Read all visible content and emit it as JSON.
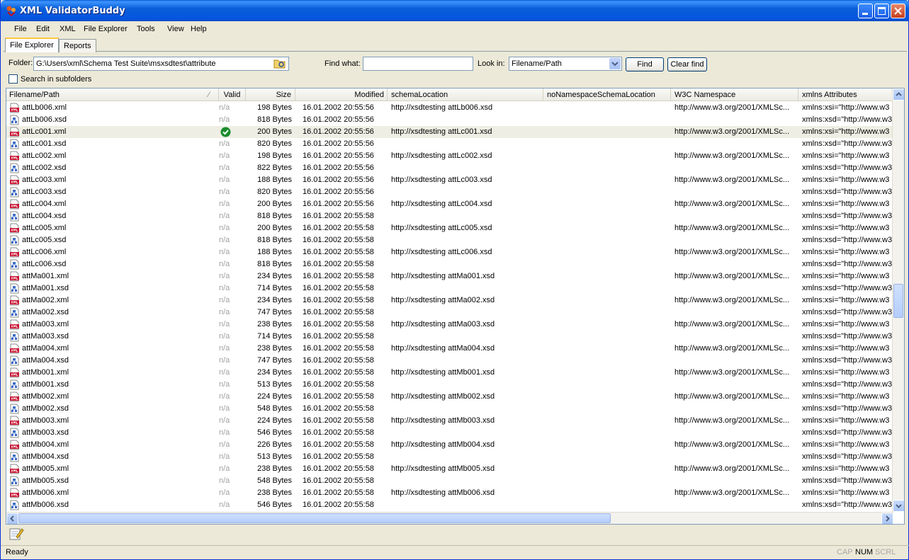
{
  "window": {
    "title": "XML ValidatorBuddy"
  },
  "menu": [
    "File",
    "Edit",
    "XML",
    "File Explorer",
    "Tools",
    "View",
    "Help"
  ],
  "tabs": [
    {
      "label": "File Explorer",
      "active": true
    },
    {
      "label": "Reports",
      "active": false
    }
  ],
  "toolbar": {
    "folder_label": "Folder:",
    "folder_value": "G:\\Users\\xml\\Schema Test Suite\\msxsdtest\\attribute",
    "find_label": "Find what:",
    "find_value": "",
    "lookin_label": "Look in:",
    "lookin_value": "Filename/Path",
    "find_button": "Find",
    "clear_button": "Clear find",
    "subfolders_label": "Search in subfolders",
    "subfolders_checked": false
  },
  "columns": [
    "Filename/Path",
    "Valid",
    "Size",
    "Modified",
    "schemaLocation",
    "noNamespaceSchemaLocation",
    "W3C Namespace",
    "xmlns Attributes"
  ],
  "rows": [
    {
      "name": "attLb006.xml",
      "type": "xml",
      "valid": "n/a",
      "size": "198 Bytes",
      "modified": "16.01.2002 20:55:56",
      "schema": "http://xsdtesting attLb006.xsd",
      "nons": "",
      "w3c": "http://www.w3.org/2001/XMLSc...",
      "xmlns": "xmlns:xsi=\"http://www.w3"
    },
    {
      "name": "attLb006.xsd",
      "type": "xsd",
      "valid": "n/a",
      "size": "818 Bytes",
      "modified": "16.01.2002 20:55:56",
      "schema": "",
      "nons": "",
      "w3c": "",
      "xmlns": "xmlns:xsd=\"http://www.w3"
    },
    {
      "name": "attLc001.xml",
      "type": "xml",
      "valid": "ok",
      "size": "200 Bytes",
      "modified": "16.01.2002 20:55:56",
      "schema": "http://xsdtesting attLc001.xsd",
      "nons": "",
      "w3c": "http://www.w3.org/2001/XMLSc...",
      "xmlns": "xmlns:xsi=\"http://www.w3",
      "selected": true
    },
    {
      "name": "attLc001.xsd",
      "type": "xsd",
      "valid": "n/a",
      "size": "820 Bytes",
      "modified": "16.01.2002 20:55:56",
      "schema": "",
      "nons": "",
      "w3c": "",
      "xmlns": "xmlns:xsd=\"http://www.w3"
    },
    {
      "name": "attLc002.xml",
      "type": "xml",
      "valid": "n/a",
      "size": "198 Bytes",
      "modified": "16.01.2002 20:55:56",
      "schema": "http://xsdtesting attLc002.xsd",
      "nons": "",
      "w3c": "http://www.w3.org/2001/XMLSc...",
      "xmlns": "xmlns:xsi=\"http://www.w3"
    },
    {
      "name": "attLc002.xsd",
      "type": "xsd",
      "valid": "n/a",
      "size": "822 Bytes",
      "modified": "16.01.2002 20:55:56",
      "schema": "",
      "nons": "",
      "w3c": "",
      "xmlns": "xmlns:xsd=\"http://www.w3"
    },
    {
      "name": "attLc003.xml",
      "type": "xml",
      "valid": "n/a",
      "size": "188 Bytes",
      "modified": "16.01.2002 20:55:56",
      "schema": "http://xsdtesting attLc003.xsd",
      "nons": "",
      "w3c": "http://www.w3.org/2001/XMLSc...",
      "xmlns": "xmlns:xsi=\"http://www.w3"
    },
    {
      "name": "attLc003.xsd",
      "type": "xsd",
      "valid": "n/a",
      "size": "820 Bytes",
      "modified": "16.01.2002 20:55:56",
      "schema": "",
      "nons": "",
      "w3c": "",
      "xmlns": "xmlns:xsd=\"http://www.w3"
    },
    {
      "name": "attLc004.xml",
      "type": "xml",
      "valid": "n/a",
      "size": "200 Bytes",
      "modified": "16.01.2002 20:55:56",
      "schema": "http://xsdtesting attLc004.xsd",
      "nons": "",
      "w3c": "http://www.w3.org/2001/XMLSc...",
      "xmlns": "xmlns:xsi=\"http://www.w3"
    },
    {
      "name": "attLc004.xsd",
      "type": "xsd",
      "valid": "n/a",
      "size": "818 Bytes",
      "modified": "16.01.2002 20:55:58",
      "schema": "",
      "nons": "",
      "w3c": "",
      "xmlns": "xmlns:xsd=\"http://www.w3"
    },
    {
      "name": "attLc005.xml",
      "type": "xml",
      "valid": "n/a",
      "size": "200 Bytes",
      "modified": "16.01.2002 20:55:58",
      "schema": "http://xsdtesting attLc005.xsd",
      "nons": "",
      "w3c": "http://www.w3.org/2001/XMLSc...",
      "xmlns": "xmlns:xsi=\"http://www.w3"
    },
    {
      "name": "attLc005.xsd",
      "type": "xsd",
      "valid": "n/a",
      "size": "818 Bytes",
      "modified": "16.01.2002 20:55:58",
      "schema": "",
      "nons": "",
      "w3c": "",
      "xmlns": "xmlns:xsd=\"http://www.w3"
    },
    {
      "name": "attLc006.xml",
      "type": "xml",
      "valid": "n/a",
      "size": "188 Bytes",
      "modified": "16.01.2002 20:55:58",
      "schema": "http://xsdtesting attLc006.xsd",
      "nons": "",
      "w3c": "http://www.w3.org/2001/XMLSc...",
      "xmlns": "xmlns:xsi=\"http://www.w3"
    },
    {
      "name": "attLc006.xsd",
      "type": "xsd",
      "valid": "n/a",
      "size": "818 Bytes",
      "modified": "16.01.2002 20:55:58",
      "schema": "",
      "nons": "",
      "w3c": "",
      "xmlns": "xmlns:xsd=\"http://www.w3"
    },
    {
      "name": "attMa001.xml",
      "type": "xml",
      "valid": "n/a",
      "size": "234 Bytes",
      "modified": "16.01.2002 20:55:58",
      "schema": "http://xsdtesting attMa001.xsd",
      "nons": "",
      "w3c": "http://www.w3.org/2001/XMLSc...",
      "xmlns": "xmlns:xsi=\"http://www.w3"
    },
    {
      "name": "attMa001.xsd",
      "type": "xsd",
      "valid": "n/a",
      "size": "714 Bytes",
      "modified": "16.01.2002 20:55:58",
      "schema": "",
      "nons": "",
      "w3c": "",
      "xmlns": "xmlns:xsd=\"http://www.w3"
    },
    {
      "name": "attMa002.xml",
      "type": "xml",
      "valid": "n/a",
      "size": "234 Bytes",
      "modified": "16.01.2002 20:55:58",
      "schema": "http://xsdtesting attMa002.xsd",
      "nons": "",
      "w3c": "http://www.w3.org/2001/XMLSc...",
      "xmlns": "xmlns:xsi=\"http://www.w3"
    },
    {
      "name": "attMa002.xsd",
      "type": "xsd",
      "valid": "n/a",
      "size": "747 Bytes",
      "modified": "16.01.2002 20:55:58",
      "schema": "",
      "nons": "",
      "w3c": "",
      "xmlns": "xmlns:xsd=\"http://www.w3"
    },
    {
      "name": "attMa003.xml",
      "type": "xml",
      "valid": "n/a",
      "size": "238 Bytes",
      "modified": "16.01.2002 20:55:58",
      "schema": "http://xsdtesting attMa003.xsd",
      "nons": "",
      "w3c": "http://www.w3.org/2001/XMLSc...",
      "xmlns": "xmlns:xsi=\"http://www.w3"
    },
    {
      "name": "attMa003.xsd",
      "type": "xsd",
      "valid": "n/a",
      "size": "714 Bytes",
      "modified": "16.01.2002 20:55:58",
      "schema": "",
      "nons": "",
      "w3c": "",
      "xmlns": "xmlns:xsd=\"http://www.w3"
    },
    {
      "name": "attMa004.xml",
      "type": "xml",
      "valid": "n/a",
      "size": "238 Bytes",
      "modified": "16.01.2002 20:55:58",
      "schema": "http://xsdtesting attMa004.xsd",
      "nons": "",
      "w3c": "http://www.w3.org/2001/XMLSc...",
      "xmlns": "xmlns:xsi=\"http://www.w3"
    },
    {
      "name": "attMa004.xsd",
      "type": "xsd",
      "valid": "n/a",
      "size": "747 Bytes",
      "modified": "16.01.2002 20:55:58",
      "schema": "",
      "nons": "",
      "w3c": "",
      "xmlns": "xmlns:xsd=\"http://www.w3"
    },
    {
      "name": "attMb001.xml",
      "type": "xml",
      "valid": "n/a",
      "size": "234 Bytes",
      "modified": "16.01.2002 20:55:58",
      "schema": "http://xsdtesting attMb001.xsd",
      "nons": "",
      "w3c": "http://www.w3.org/2001/XMLSc...",
      "xmlns": "xmlns:xsi=\"http://www.w3"
    },
    {
      "name": "attMb001.xsd",
      "type": "xsd",
      "valid": "n/a",
      "size": "513 Bytes",
      "modified": "16.01.2002 20:55:58",
      "schema": "",
      "nons": "",
      "w3c": "",
      "xmlns": "xmlns:xsd=\"http://www.w3"
    },
    {
      "name": "attMb002.xml",
      "type": "xml",
      "valid": "n/a",
      "size": "224 Bytes",
      "modified": "16.01.2002 20:55:58",
      "schema": "http://xsdtesting attMb002.xsd",
      "nons": "",
      "w3c": "http://www.w3.org/2001/XMLSc...",
      "xmlns": "xmlns:xsi=\"http://www.w3"
    },
    {
      "name": "attMb002.xsd",
      "type": "xsd",
      "valid": "n/a",
      "size": "548 Bytes",
      "modified": "16.01.2002 20:55:58",
      "schema": "",
      "nons": "",
      "w3c": "",
      "xmlns": "xmlns:xsd=\"http://www.w3"
    },
    {
      "name": "attMb003.xml",
      "type": "xml",
      "valid": "n/a",
      "size": "224 Bytes",
      "modified": "16.01.2002 20:55:58",
      "schema": "http://xsdtesting attMb003.xsd",
      "nons": "",
      "w3c": "http://www.w3.org/2001/XMLSc...",
      "xmlns": "xmlns:xsi=\"http://www.w3"
    },
    {
      "name": "attMb003.xsd",
      "type": "xsd",
      "valid": "n/a",
      "size": "546 Bytes",
      "modified": "16.01.2002 20:55:58",
      "schema": "",
      "nons": "",
      "w3c": "",
      "xmlns": "xmlns:xsd=\"http://www.w3"
    },
    {
      "name": "attMb004.xml",
      "type": "xml",
      "valid": "n/a",
      "size": "226 Bytes",
      "modified": "16.01.2002 20:55:58",
      "schema": "http://xsdtesting attMb004.xsd",
      "nons": "",
      "w3c": "http://www.w3.org/2001/XMLSc...",
      "xmlns": "xmlns:xsi=\"http://www.w3"
    },
    {
      "name": "attMb004.xsd",
      "type": "xsd",
      "valid": "n/a",
      "size": "513 Bytes",
      "modified": "16.01.2002 20:55:58",
      "schema": "",
      "nons": "",
      "w3c": "",
      "xmlns": "xmlns:xsd=\"http://www.w3"
    },
    {
      "name": "attMb005.xml",
      "type": "xml",
      "valid": "n/a",
      "size": "238 Bytes",
      "modified": "16.01.2002 20:55:58",
      "schema": "http://xsdtesting attMb005.xsd",
      "nons": "",
      "w3c": "http://www.w3.org/2001/XMLSc...",
      "xmlns": "xmlns:xsi=\"http://www.w3"
    },
    {
      "name": "attMb005.xsd",
      "type": "xsd",
      "valid": "n/a",
      "size": "548 Bytes",
      "modified": "16.01.2002 20:55:58",
      "schema": "",
      "nons": "",
      "w3c": "",
      "xmlns": "xmlns:xsd=\"http://www.w3"
    },
    {
      "name": "attMb006.xml",
      "type": "xml",
      "valid": "n/a",
      "size": "238 Bytes",
      "modified": "16.01.2002 20:55:58",
      "schema": "http://xsdtesting attMb006.xsd",
      "nons": "",
      "w3c": "http://www.w3.org/2001/XMLSc...",
      "xmlns": "xmlns:xsi=\"http://www.w3"
    },
    {
      "name": "attMb006.xsd",
      "type": "xsd",
      "valid": "n/a",
      "size": "546 Bytes",
      "modified": "16.01.2002 20:55:58",
      "schema": "",
      "nons": "",
      "w3c": "",
      "xmlns": "xmlns:xsd=\"http://www.w3"
    }
  ],
  "status": {
    "text": "Ready",
    "indicators": [
      {
        "label": "CAP",
        "active": false
      },
      {
        "label": "NUM",
        "active": true
      },
      {
        "label": "SCRL",
        "active": false
      }
    ]
  },
  "colors": {
    "xml_icon": "#c8102e",
    "xsd_icon": "#3a6bc8",
    "valid_ok": "#1a8c2e",
    "selection": "#eeeee4"
  },
  "icons": {
    "app": "buddy-app-icon",
    "folder_browse": "folder-open-icon",
    "bottom_tool": "edit-note-icon"
  }
}
